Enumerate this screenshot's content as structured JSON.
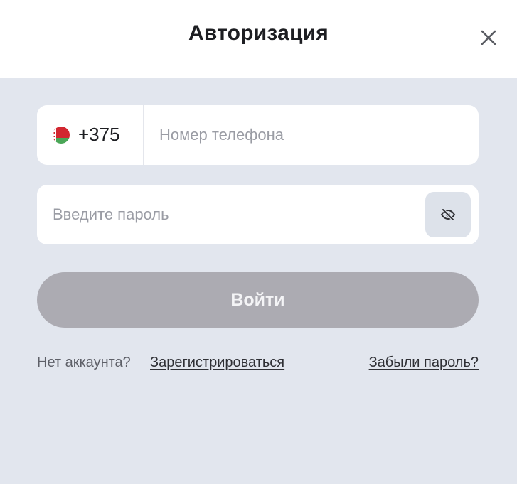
{
  "header": {
    "title": "Авторизация",
    "close_icon": "close-icon"
  },
  "phone": {
    "country_flag": "belarus-flag-icon",
    "country_code": "+375",
    "placeholder": "Номер телефона",
    "value": ""
  },
  "password": {
    "placeholder": "Введите пароль",
    "value": "",
    "toggle_icon": "eye-off-icon"
  },
  "login_button": {
    "label": "Войти"
  },
  "footer": {
    "no_account_text": "Нет аккаунта?",
    "register_link": "Зарегистрироваться",
    "forgot_link": "Забыли пароль?"
  },
  "colors": {
    "background": "#e2e6ee",
    "button_disabled": "#acabb2",
    "flag_red": "#d22730",
    "flag_green": "#4aa657"
  }
}
